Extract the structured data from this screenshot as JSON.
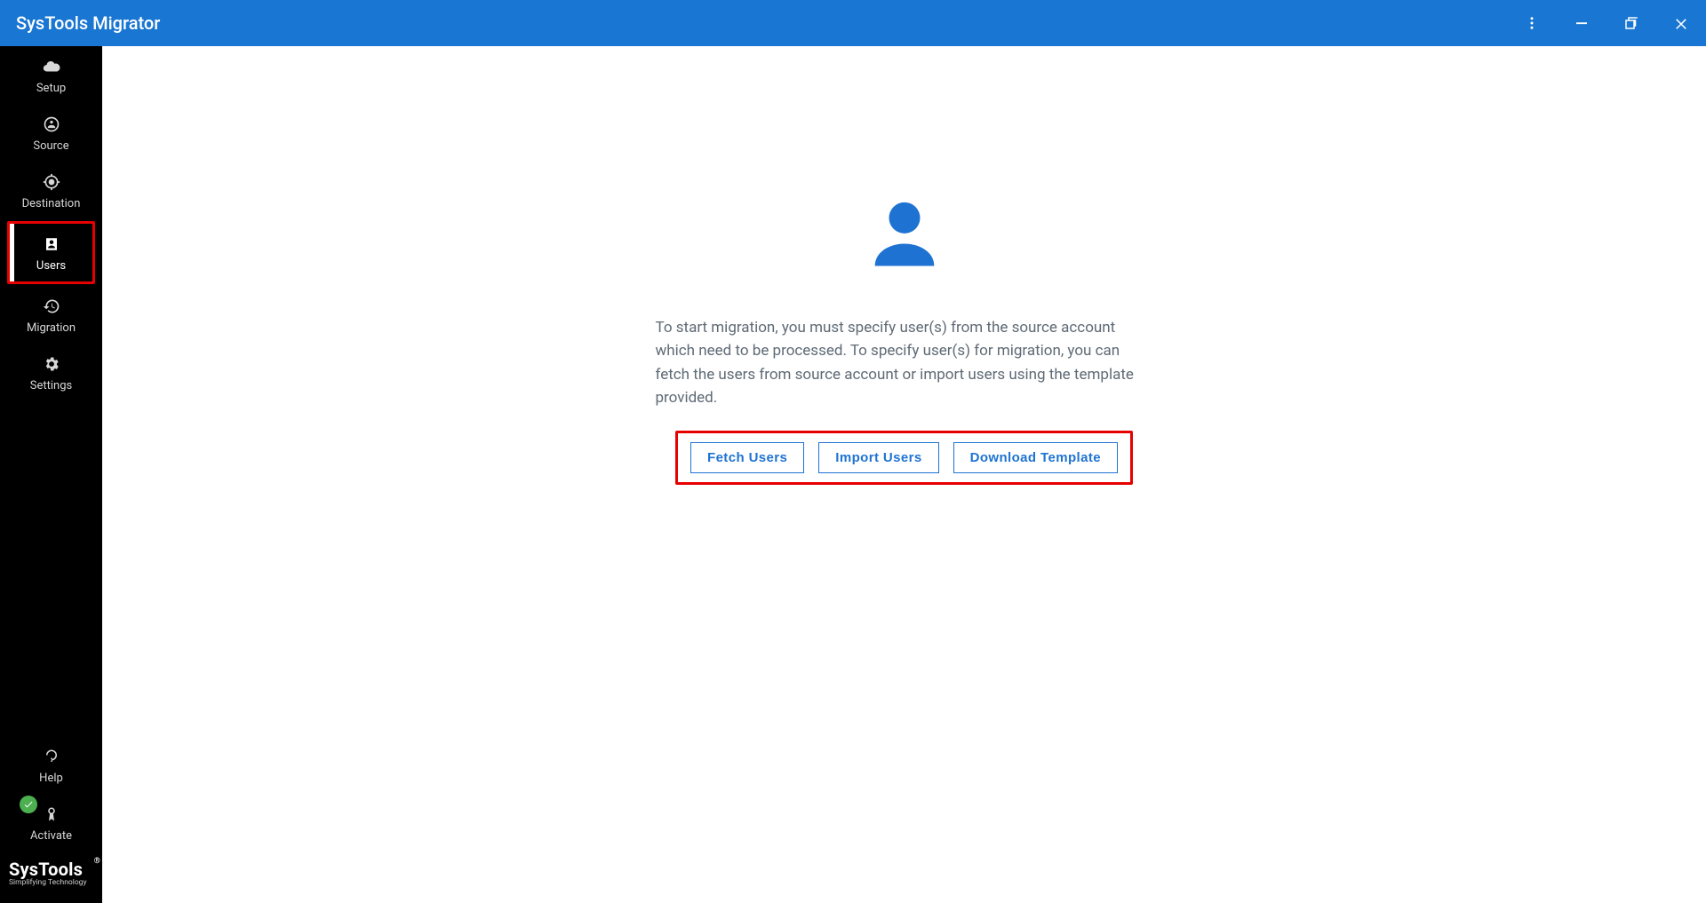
{
  "titlebar": {
    "title": "SysTools Migrator"
  },
  "sidebar": {
    "items": [
      {
        "id": "setup",
        "label": "Setup"
      },
      {
        "id": "source",
        "label": "Source"
      },
      {
        "id": "destination",
        "label": "Destination"
      },
      {
        "id": "users",
        "label": "Users"
      },
      {
        "id": "migration",
        "label": "Migration"
      },
      {
        "id": "settings",
        "label": "Settings"
      }
    ],
    "footer_items": [
      {
        "id": "help",
        "label": "Help"
      },
      {
        "id": "activate",
        "label": "Activate"
      }
    ],
    "logo": {
      "brand": "SysTools",
      "tagline": "Simplifying Technology"
    }
  },
  "main": {
    "description": "To start migration, you must specify user(s) from the source account which need to be processed. To specify user(s) for migration, you can fetch the users from source account or import users using the template provided.",
    "buttons": {
      "fetch": "Fetch Users",
      "import": "Import Users",
      "download": "Download Template"
    }
  },
  "highlight_colors": {
    "annotation_red": "#e60000",
    "accent_blue": "#1e73d2"
  }
}
